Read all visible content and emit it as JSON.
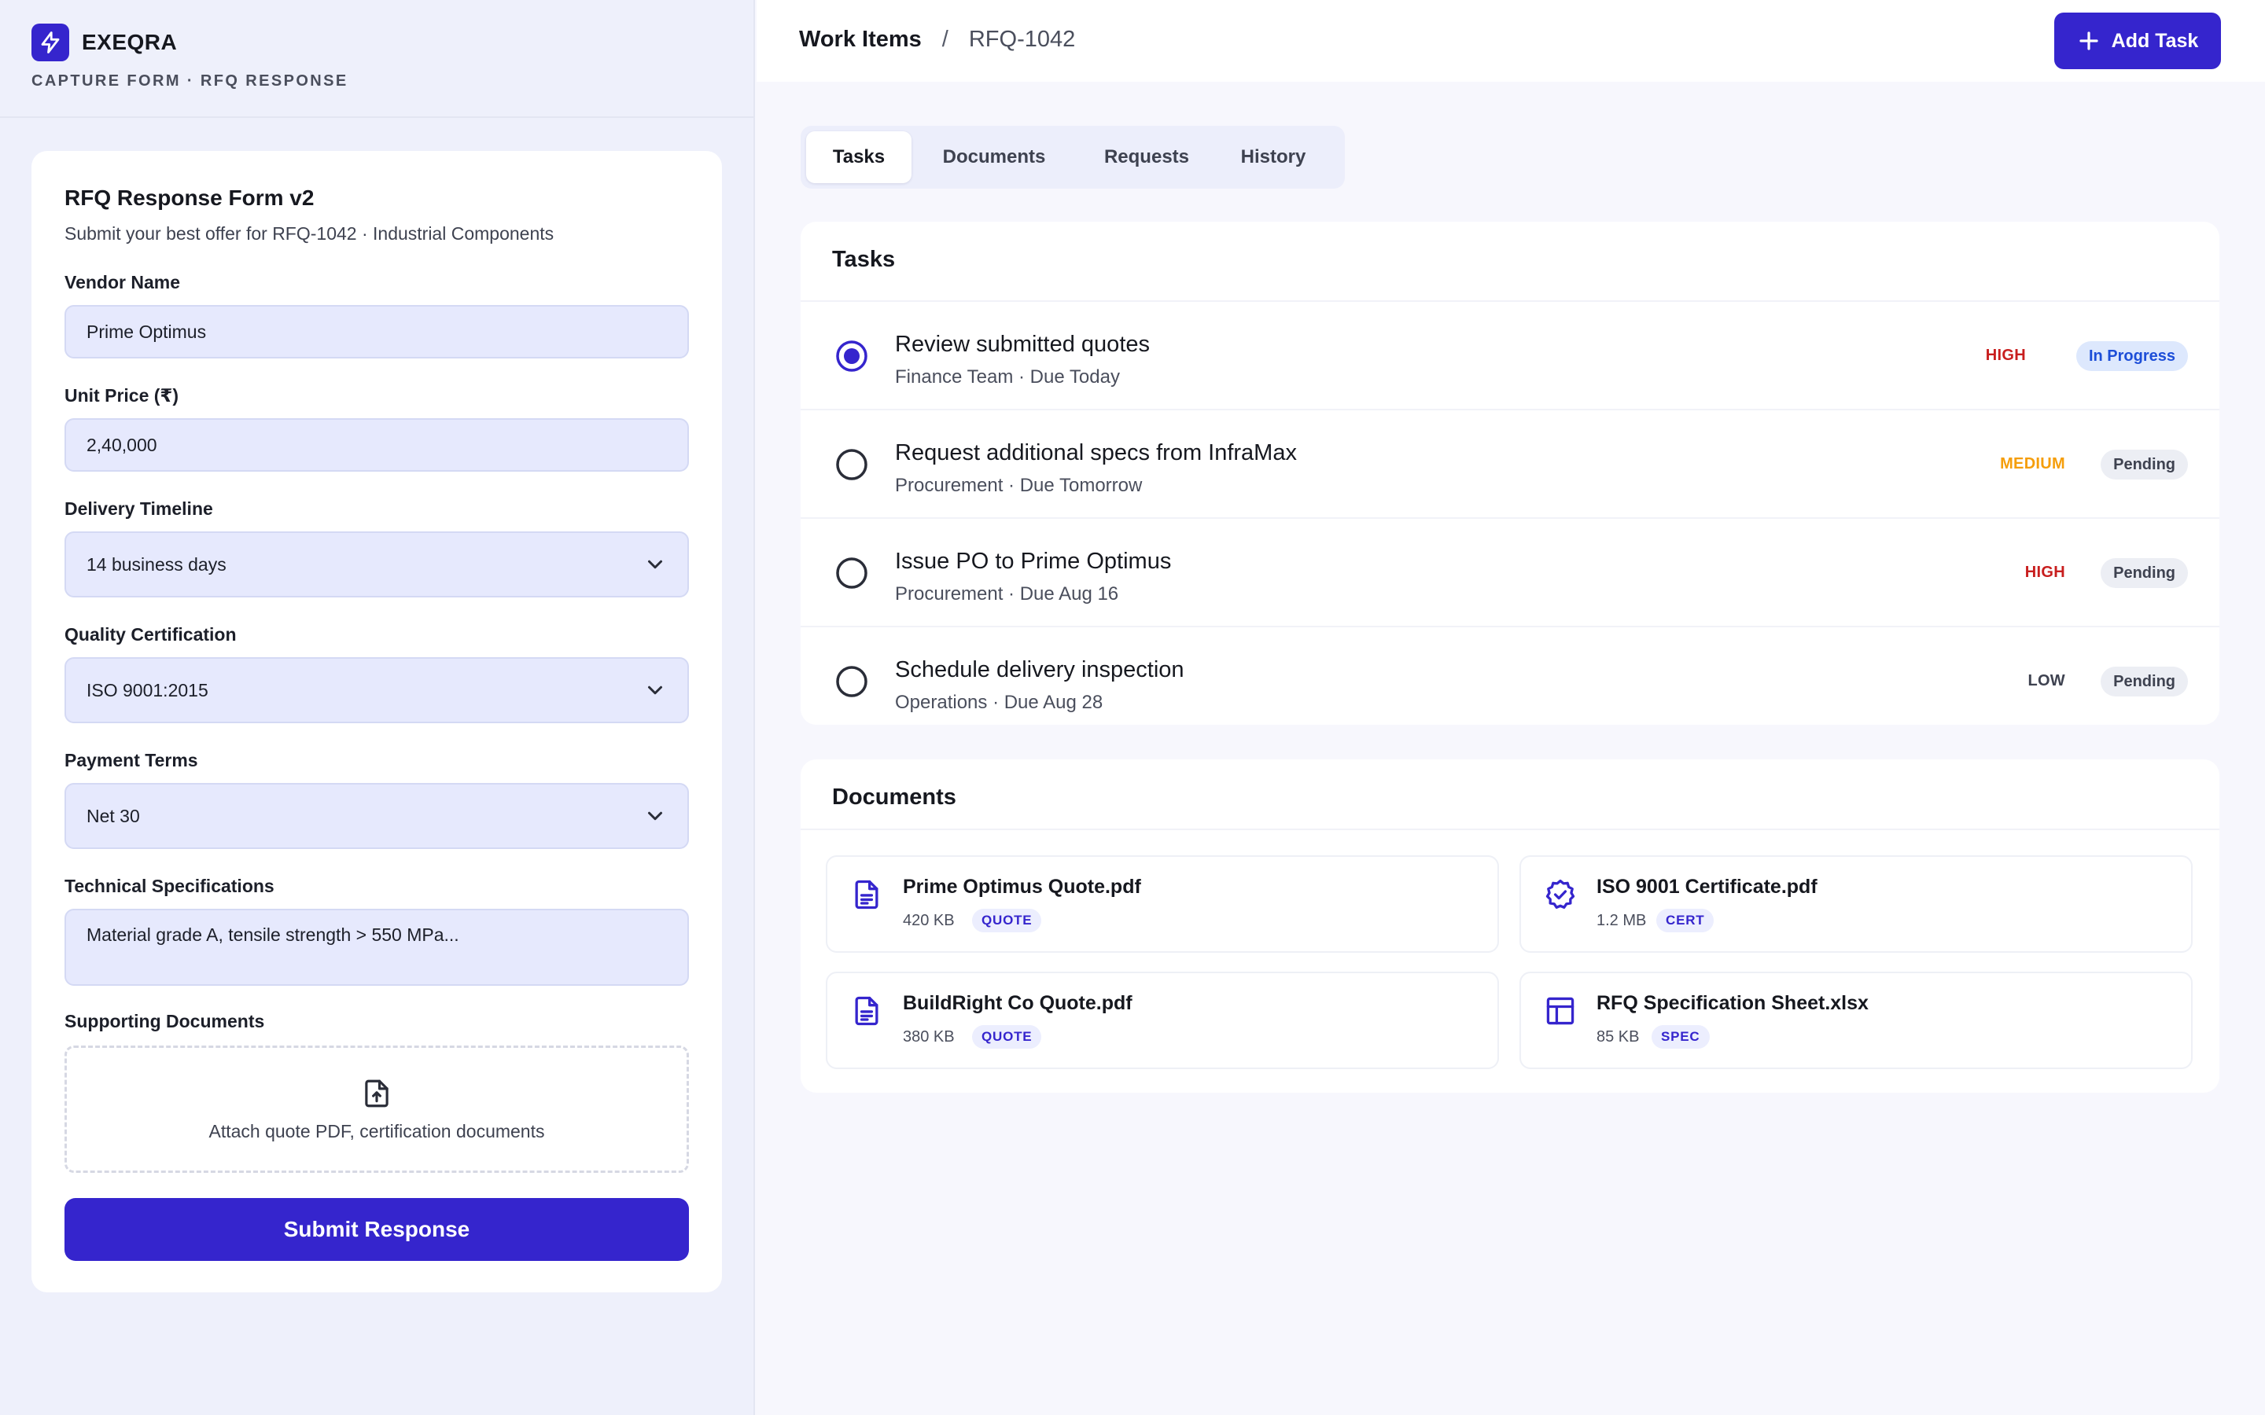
{
  "brand": {
    "name": "EXEQRA",
    "subtitle": "CAPTURE FORM · RFQ RESPONSE"
  },
  "form": {
    "title": "RFQ Response Form v2",
    "description": "Submit your best offer for RFQ-1042 · Industrial Components",
    "vendor": {
      "label": "Vendor Name",
      "value": "Prime Optimus"
    },
    "unit_price": {
      "label": "Unit Price (₹)",
      "value": "2,40,000"
    },
    "delivery": {
      "label": "Delivery Timeline",
      "value": "14 business days"
    },
    "quality": {
      "label": "Quality Certification",
      "value": "ISO 9001:2015"
    },
    "payment": {
      "label": "Payment Terms",
      "value": "Net 30"
    },
    "specs": {
      "label": "Technical Specifications",
      "value": "Material grade A, tensile strength > 550 MPa..."
    },
    "supporting": {
      "label": "Supporting Documents",
      "dropzone_text": "Attach quote PDF, certification documents"
    },
    "submit_label": "Submit Response"
  },
  "header": {
    "breadcrumb_root": "Work Items",
    "breadcrumb_sep": "/",
    "breadcrumb_current": "RFQ-1042",
    "add_task_label": "Add Task"
  },
  "tabs": [
    {
      "label": "Tasks",
      "active": true
    },
    {
      "label": "Documents",
      "active": false
    },
    {
      "label": "Requests",
      "active": false
    },
    {
      "label": "History",
      "active": false
    }
  ],
  "tasks": {
    "title": "Tasks",
    "items": [
      {
        "title": "Review submitted quotes",
        "meta": "Finance Team · Due Today",
        "priority": "HIGH",
        "status": "In Progress",
        "selected": true
      },
      {
        "title": "Request additional specs from InfraMax",
        "meta": "Procurement · Due Tomorrow",
        "priority": "MEDIUM",
        "status": "Pending",
        "selected": false
      },
      {
        "title": "Issue PO to Prime Optimus",
        "meta": "Procurement · Due Aug 16",
        "priority": "HIGH",
        "status": "Pending",
        "selected": false
      },
      {
        "title": "Schedule delivery inspection",
        "meta": "Operations · Due Aug 28",
        "priority": "LOW",
        "status": "Pending",
        "selected": false
      }
    ]
  },
  "documents": {
    "title": "Documents",
    "items": [
      {
        "name": "Prime Optimus Quote.pdf",
        "size": "420 KB",
        "tag": "QUOTE",
        "icon": "document-icon"
      },
      {
        "name": "ISO 9001 Certificate.pdf",
        "size": "1.2 MB",
        "tag": "CERT",
        "icon": "certificate-badge-icon"
      },
      {
        "name": "BuildRight Co Quote.pdf",
        "size": "380 KB",
        "tag": "QUOTE",
        "icon": "document-icon"
      },
      {
        "name": "RFQ Specification Sheet.xlsx",
        "size": "85 KB",
        "tag": "SPEC",
        "icon": "spreadsheet-icon"
      }
    ]
  },
  "colors": {
    "accent": "#3525cd",
    "priority_high": "#c81e1e",
    "priority_medium": "#f59e0b",
    "priority_low": "#3e4250",
    "status_in_progress_bg": "#dde8fd",
    "status_in_progress_fg": "#1d4ed8",
    "status_pending_bg": "#eceef4",
    "status_pending_fg": "#3e4250"
  }
}
